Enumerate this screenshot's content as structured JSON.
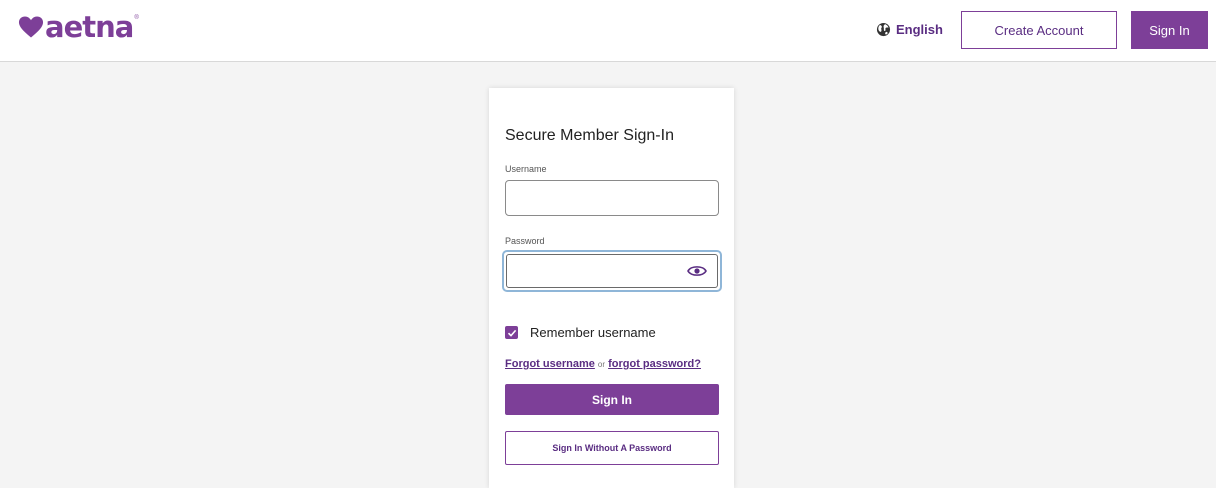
{
  "header": {
    "logo_text": "aetna",
    "logo_reg": "®",
    "language_label": "English",
    "create_account_label": "Create Account",
    "sign_in_label": "Sign In"
  },
  "form": {
    "title": "Secure Member Sign-In",
    "username_label": "Username",
    "username_value": "",
    "password_label": "Password",
    "password_value": "",
    "remember_label": "Remember username",
    "remember_checked": true,
    "forgot_username_label": "Forgot username",
    "forgot_or": "or",
    "forgot_password_label": "forgot password?",
    "sign_in_button": "Sign In",
    "sign_in_without_password_button": "Sign In Without A Password"
  },
  "icons": {
    "logo": "heart-icon",
    "language": "globe-icon",
    "password_toggle": "eye-icon",
    "checkbox": "checkmark-icon"
  },
  "colors": {
    "brand_purple": "#7d3f98",
    "dark_purple": "#5a2d82",
    "page_background": "#f4f4f4",
    "focus_ring": "#8fb6d8"
  }
}
